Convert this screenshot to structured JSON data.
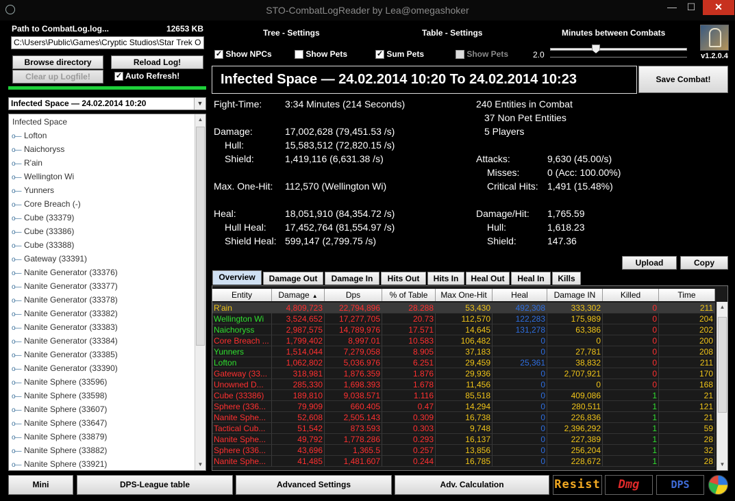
{
  "window": {
    "title": "STO-CombatLogReader by Lea@omegashoker",
    "min": "—",
    "max": "☐",
    "close": "✕"
  },
  "left": {
    "path_label": "Path to CombatLog.log...",
    "size": "12653 KB",
    "path_value": "C:\\Users\\Public\\Games\\Cryptic Studios\\Star Trek O",
    "browse": "Browse directory",
    "reload": "Reload Log!",
    "clear": "Clear up Logfile!",
    "autorefresh": "Auto Refresh!",
    "combat_select": "Infected Space — 24.02.2014 10:20",
    "tree_root": "Infected Space",
    "tree_items": [
      "Lofton",
      "Naichoryss",
      "R'ain",
      "Wellington Wi",
      "Yunners",
      "Core Breach (-)",
      "Cube (33379)",
      "Cube (33386)",
      "Cube (33388)",
      "Gateway (33391)",
      "Nanite Generator (33376)",
      "Nanite Generator (33377)",
      "Nanite Generator (33378)",
      "Nanite Generator (33382)",
      "Nanite Generator (33383)",
      "Nanite Generator (33384)",
      "Nanite Generator (33385)",
      "Nanite Generator (33390)",
      "Nanite Sphere (33596)",
      "Nanite Sphere (33598)",
      "Nanite Sphere (33607)",
      "Nanite Sphere (33647)",
      "Nanite Sphere (33879)",
      "Nanite Sphere (33882)",
      "Nanite Sphere (33921)"
    ]
  },
  "header": {
    "tree_settings": "Tree - Settings",
    "table_settings": "Table - Settings",
    "minutes_between": "Minutes between Combats",
    "show_npcs": "Show NPCs",
    "show_pets": "Show Pets",
    "sum_pets": "Sum Pets",
    "show_pets_table": "Show Pets",
    "slider_value": "2.0",
    "version": "v1.2.0.4",
    "combat_title": "Infected Space — 24.02.2014 10:20 To 24.02.2014 10:23",
    "save": "Save Combat!"
  },
  "stats": {
    "fight_time_label": "Fight-Time:",
    "fight_time": "3:34 Minutes (214 Seconds)",
    "damage_label": "Damage:",
    "damage": "17,002,628 (79,451.53 /s)",
    "hull_label": "Hull:",
    "hull": "15,583,512 (72,820.15 /s)",
    "shield_label": "Shield:",
    "shield": "1,419,116 (6,631.38 /s)",
    "maxhit_label": "Max. One-Hit:",
    "maxhit": "112,570 (Wellington Wi)",
    "heal_label": "Heal:",
    "heal": "18,051,910 (84,354.72 /s)",
    "hullheal_label": "Hull Heal:",
    "hullheal": "17,452,764 (81,554.97 /s)",
    "shieldheal_label": "Shield Heal:",
    "shieldheal": "599,147 (2,799.75 /s)",
    "entities": "240 Entities in Combat",
    "nonpet": "37 Non Pet Entities",
    "players": "5 Players",
    "attacks_label": "Attacks:",
    "attacks": "9,630 (45.00/s)",
    "misses_label": "Misses:",
    "misses": "0 (Acc: 100.00%)",
    "crit_label": "Critical Hits:",
    "crit": "1,491 (15.48%)",
    "dph_label": "Damage/Hit:",
    "dph": "1,765.59",
    "dph_hull_label": "Hull:",
    "dph_hull": "1,618.23",
    "dph_shield_label": "Shield:",
    "dph_shield": "147.36"
  },
  "actions": {
    "upload": "Upload",
    "copy": "Copy"
  },
  "tabs": [
    "Overview",
    "Damage Out",
    "Damage In",
    "Hits Out",
    "Hits In",
    "Heal Out",
    "Heal In",
    "Kills"
  ],
  "table": {
    "columns": [
      "Entity",
      "Damage",
      "Dps",
      "% of Table",
      "Max One-Hit",
      "Heal",
      "Damage IN",
      "Killed",
      "Time"
    ],
    "sort_indicator": "▲",
    "rows": [
      {
        "c": [
          "R'ain",
          "4,809,723",
          "22,794,896",
          "28.288",
          "53,430",
          "492,308",
          "333,302",
          "0",
          "211"
        ],
        "color": "#f0c419",
        "selected": true
      },
      {
        "c": [
          "Wellington Wi",
          "3,524,652",
          "17,277,705",
          "20.73",
          "112,570",
          "122,283",
          "175,989",
          "0",
          "204"
        ],
        "color": "#2fe02f"
      },
      {
        "c": [
          "Naichoryss",
          "2,987,575",
          "14,789,976",
          "17.571",
          "14,645",
          "131,278",
          "63,386",
          "0",
          "202"
        ],
        "color": "#2fe02f"
      },
      {
        "c": [
          "Core Breach ...",
          "1,799,402",
          "8,997.01",
          "10.583",
          "106,482",
          "0",
          "0",
          "0",
          "200"
        ],
        "color": "#ff3030"
      },
      {
        "c": [
          "Yunners",
          "1,514,044",
          "7,279,058",
          "8.905",
          "37,183",
          "0",
          "27,781",
          "0",
          "208"
        ],
        "color": "#2fe02f"
      },
      {
        "c": [
          "Lofton",
          "1,062,802",
          "5,036.976",
          "6.251",
          "29,459",
          "25,361",
          "38,832",
          "0",
          "211"
        ],
        "color": "#2fe02f"
      },
      {
        "c": [
          "Gateway (33...",
          "318,981",
          "1,876.359",
          "1.876",
          "29,936",
          "0",
          "2,707,921",
          "0",
          "170"
        ],
        "color": "#ff3030"
      },
      {
        "c": [
          "Unowned D...",
          "285,330",
          "1,698.393",
          "1.678",
          "11,456",
          "0",
          "0",
          "0",
          "168"
        ],
        "color": "#ff3030"
      },
      {
        "c": [
          "Cube (33386)",
          "189,810",
          "9,038.571",
          "1.116",
          "85,518",
          "0",
          "409,086",
          "1",
          "21"
        ],
        "color": "#ff3030"
      },
      {
        "c": [
          "Sphere (336...",
          "79,909",
          "660.405",
          "0.47",
          "14,294",
          "0",
          "280,511",
          "1",
          "121"
        ],
        "color": "#ff3030"
      },
      {
        "c": [
          "Nanite Sphe...",
          "52,608",
          "2,505.143",
          "0.309",
          "16,738",
          "0",
          "226,836",
          "1",
          "21"
        ],
        "color": "#ff3030"
      },
      {
        "c": [
          "Tactical Cub...",
          "51,542",
          "873.593",
          "0.303",
          "9,748",
          "0",
          "2,396,292",
          "1",
          "59"
        ],
        "color": "#ff3030"
      },
      {
        "c": [
          "Nanite Sphe...",
          "49,792",
          "1,778.286",
          "0.293",
          "16,137",
          "0",
          "227,389",
          "1",
          "28"
        ],
        "color": "#ff3030"
      },
      {
        "c": [
          "Sphere (336...",
          "43,696",
          "1,365.5",
          "0.257",
          "13,856",
          "0",
          "256,204",
          "1",
          "32"
        ],
        "color": "#ff3030"
      },
      {
        "c": [
          "Nanite Sphe...",
          "41,485",
          "1,481.607",
          "0.244",
          "16,785",
          "0",
          "228,672",
          "1",
          "28"
        ],
        "color": "#ff3030"
      }
    ],
    "column_colors": {
      "damage": "#ff3030",
      "dps": "#ff3030",
      "pct": "#ff3030",
      "maxhit": "#f0c419",
      "heal": "#2f6fe0",
      "dmgin": "#f0c419"
    }
  },
  "bottom": {
    "mini": "Mini",
    "league": "DPS-League table",
    "advanced": "Advanced Settings",
    "adv_calc": "Adv. Calculation",
    "resist": "Resist",
    "dmg": "Dmg",
    "dps": "DPS"
  }
}
